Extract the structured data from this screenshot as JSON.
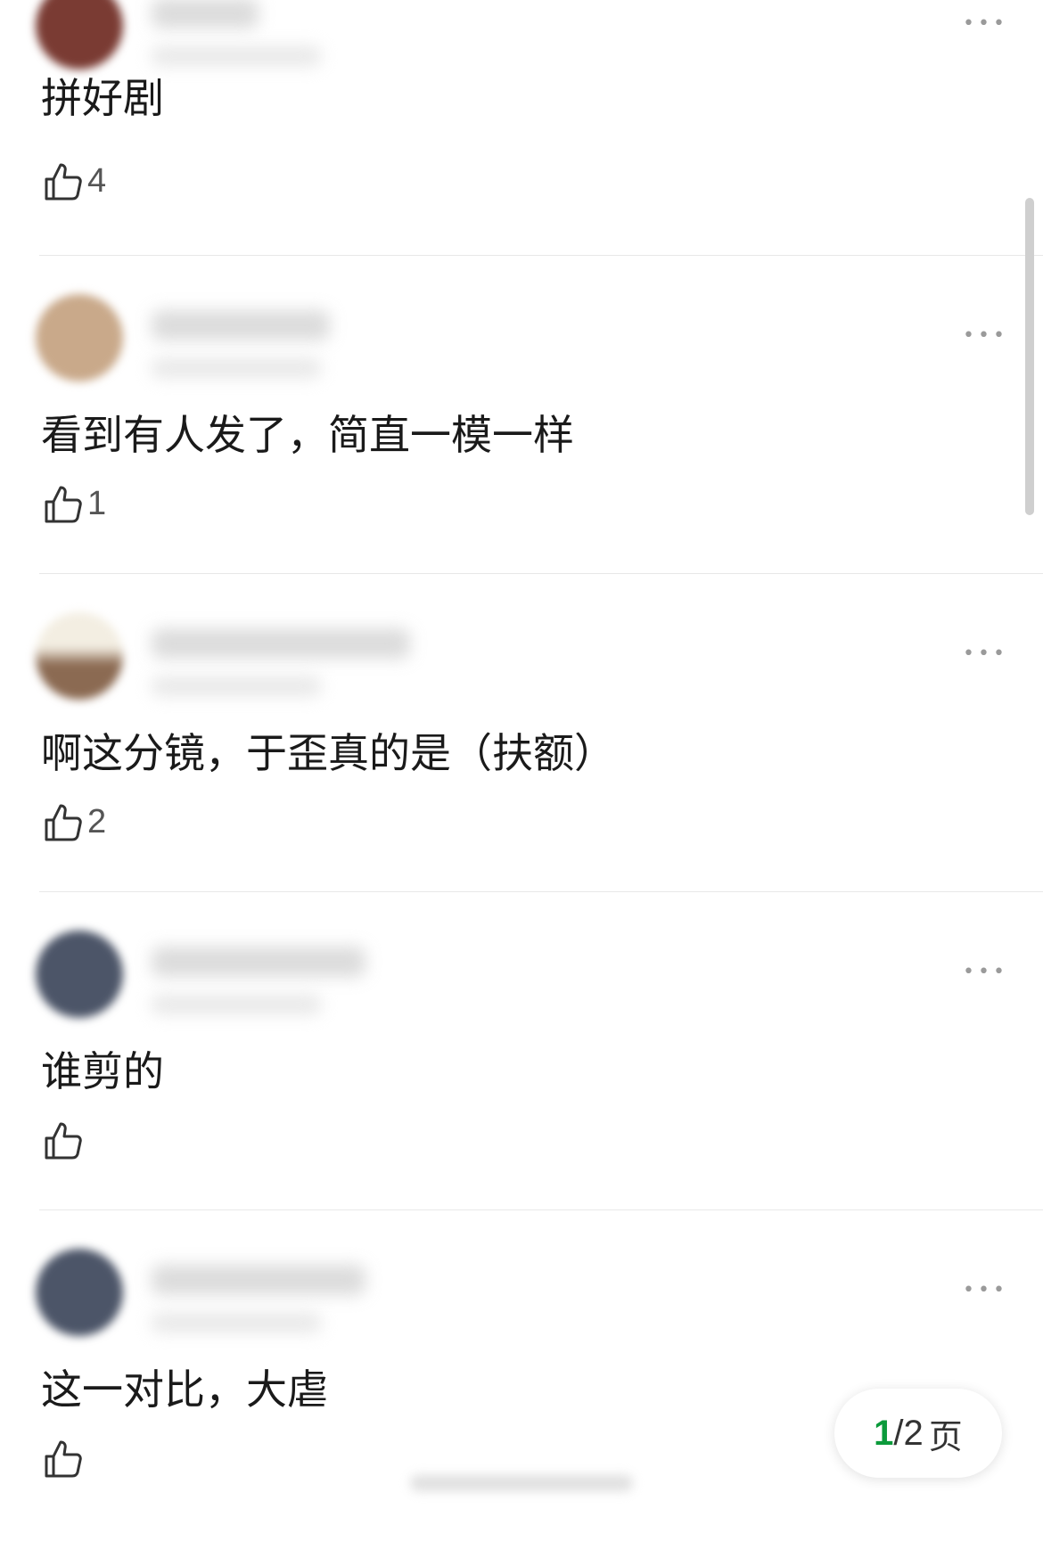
{
  "comments": [
    {
      "text": "拼好剧",
      "likes": "4",
      "avatar_color": "#7a3b33"
    },
    {
      "text": "看到有人发了，简直一模一样",
      "likes": "1",
      "avatar_color": "#c9a98a"
    },
    {
      "text": "啊这分镜，于歪真的是（扶额）",
      "likes": "2",
      "avatar_color": "#8b6a52"
    },
    {
      "text": "谁剪的",
      "likes": "",
      "avatar_color": "#4c5568"
    },
    {
      "text": "这一对比，大虐",
      "likes": "",
      "avatar_color": "#4c5568"
    }
  ],
  "more_label": "•••",
  "pager": {
    "current": "1",
    "separator": "/",
    "total": "2",
    "unit": "页"
  },
  "icons": {
    "like": "thumbs-up-icon",
    "more": "more-options-icon"
  },
  "colors": {
    "accent": "#0b9a3b",
    "divider": "#e8e8e8",
    "text": "#1a1a1a"
  }
}
